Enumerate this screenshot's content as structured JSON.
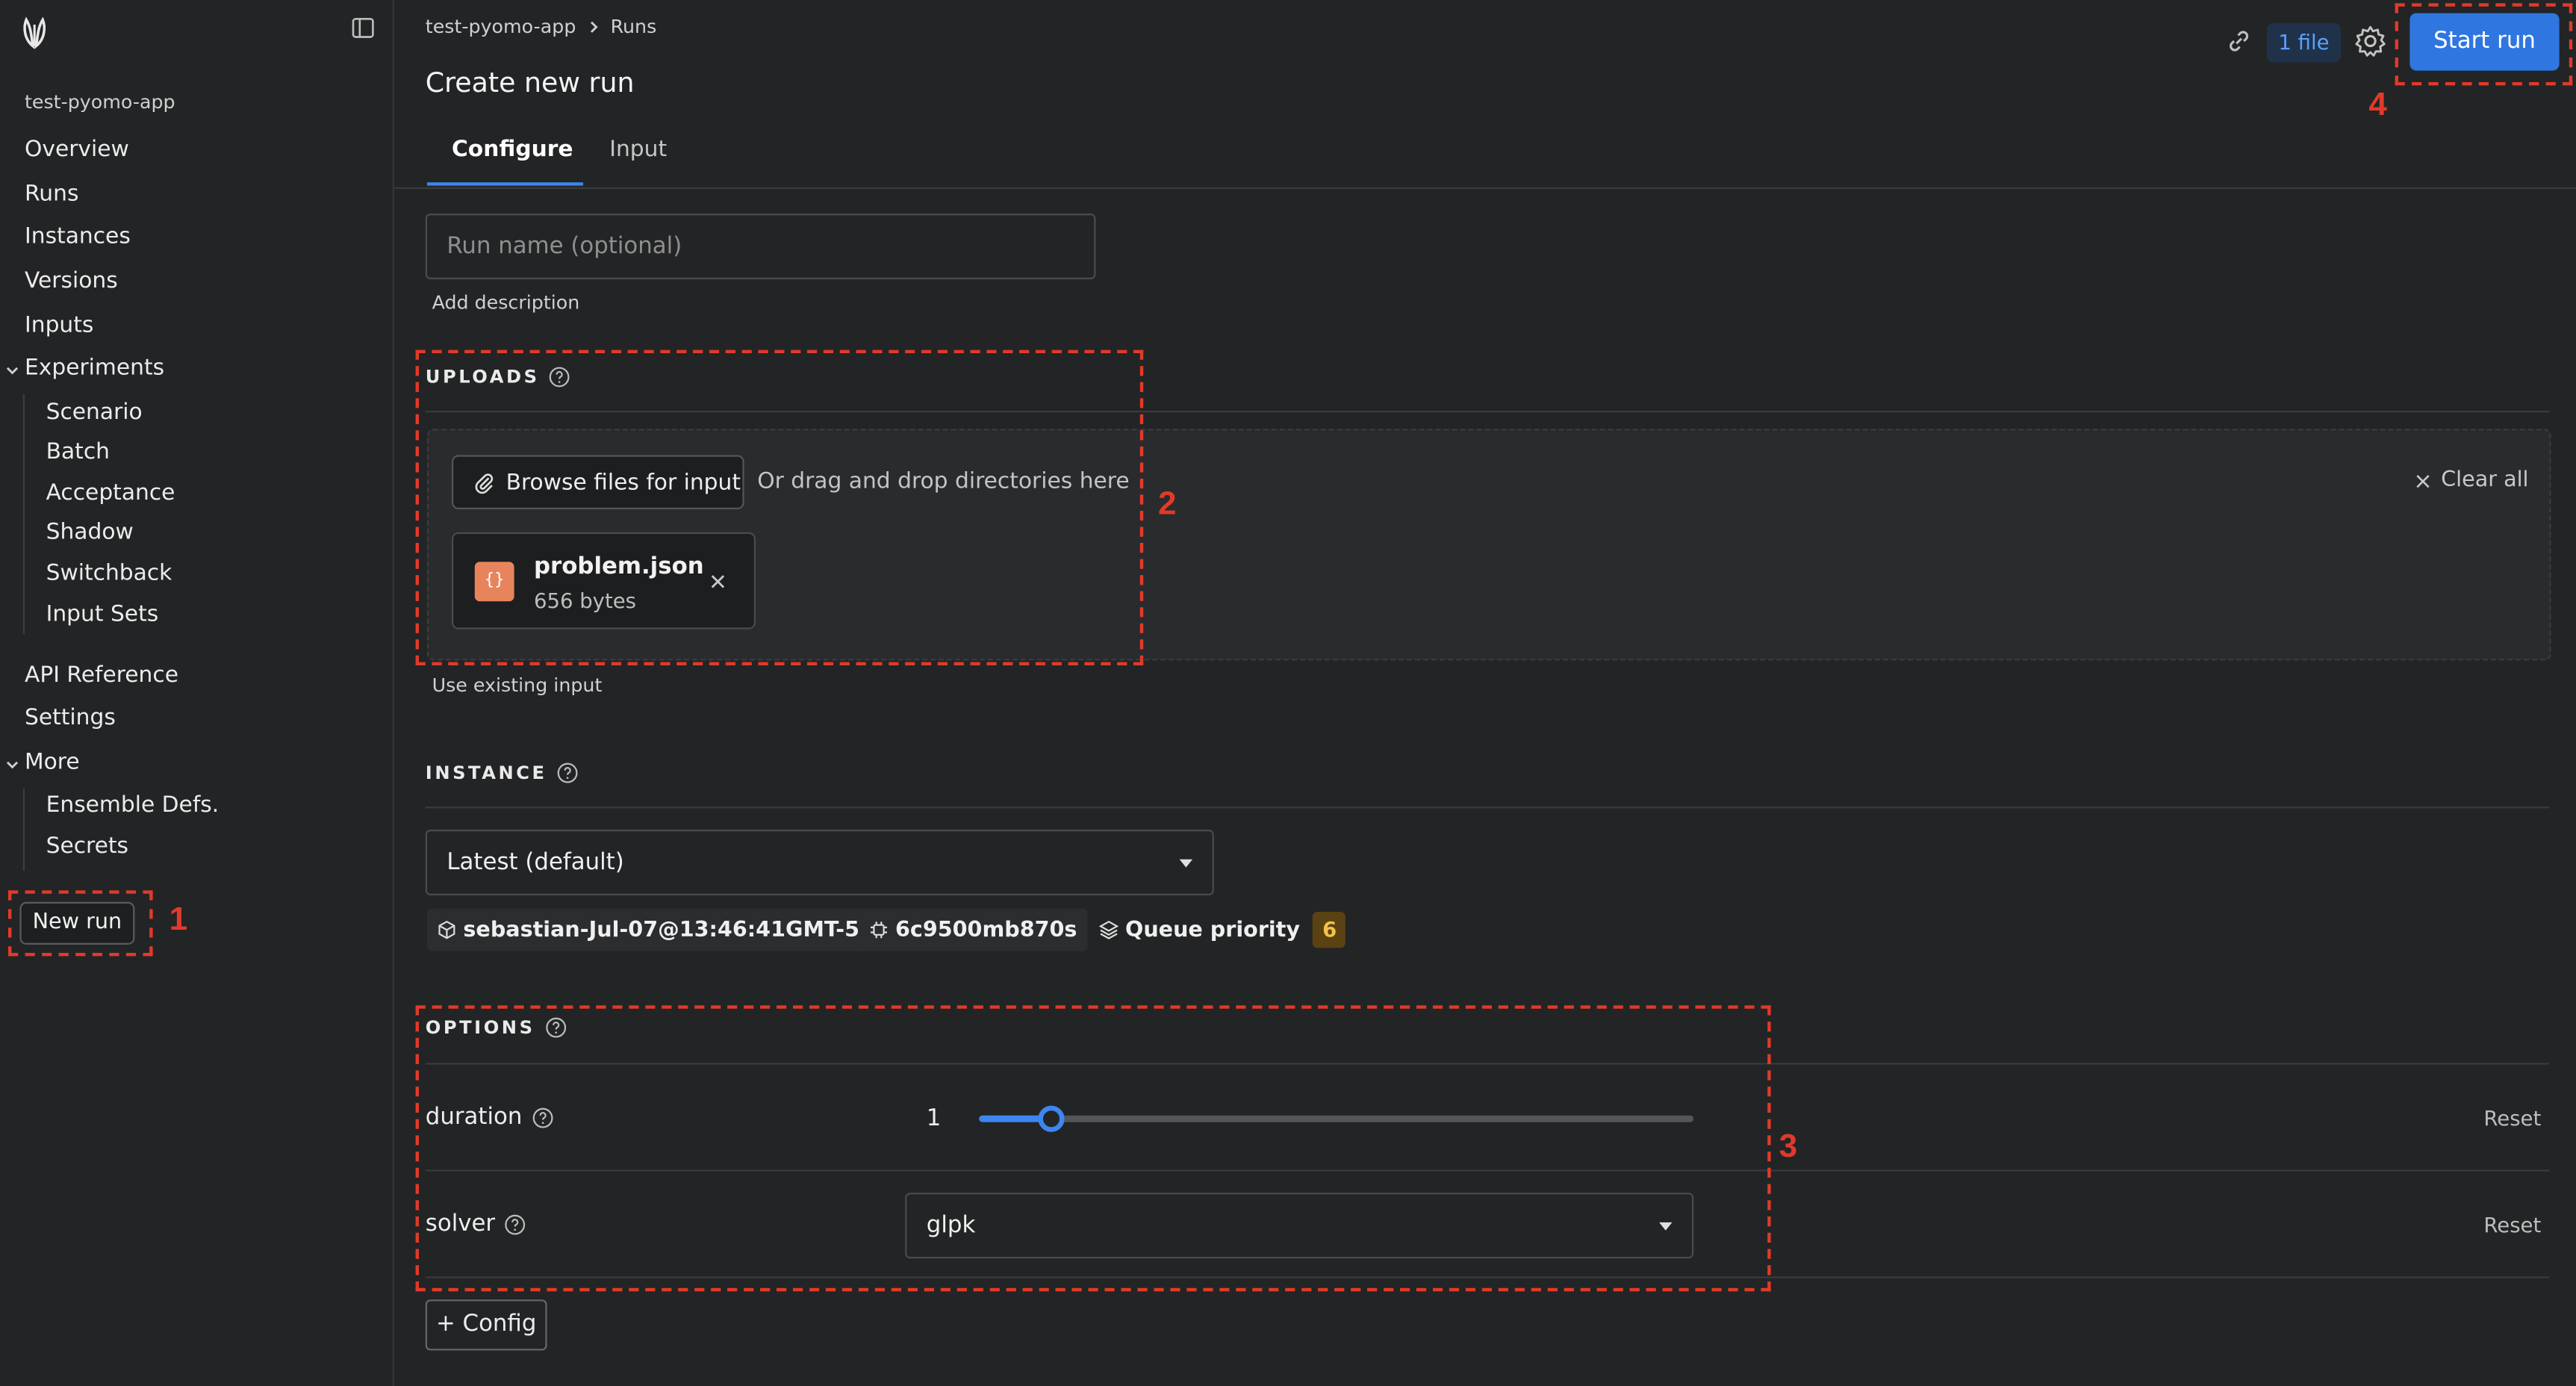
{
  "sidebar": {
    "app_name": "test-pyomo-app",
    "items": [
      {
        "label": "Overview"
      },
      {
        "label": "Runs"
      },
      {
        "label": "Instances"
      },
      {
        "label": "Versions"
      },
      {
        "label": "Inputs"
      },
      {
        "label": "Experiments"
      },
      {
        "label": "Scenario"
      },
      {
        "label": "Batch"
      },
      {
        "label": "Acceptance"
      },
      {
        "label": "Shadow"
      },
      {
        "label": "Switchback"
      },
      {
        "label": "Input Sets"
      },
      {
        "label": "API Reference"
      },
      {
        "label": "Settings"
      },
      {
        "label": "More"
      },
      {
        "label": "Ensemble Defs."
      },
      {
        "label": "Secrets"
      }
    ],
    "new_run_label": "New run"
  },
  "header": {
    "breadcrumb": [
      "test-pyomo-app",
      "Runs"
    ],
    "title": "Create new run",
    "file_badge": "1 file",
    "start_run_label": "Start run"
  },
  "tabs": [
    {
      "label": "Configure",
      "active": true
    },
    {
      "label": "Input",
      "active": false
    }
  ],
  "configure": {
    "run_name_placeholder": "Run name (optional)",
    "add_description": "Add description"
  },
  "uploads": {
    "label": "UPLOADS",
    "browse_label": "Browse files for input",
    "drag_text": "Or drag and drop directories here",
    "clear_all": "Clear all",
    "file": {
      "name": "problem.json",
      "size": "656 bytes",
      "icon_glyph": "{}"
    },
    "use_existing": "Use existing input"
  },
  "instance": {
    "label": "INSTANCE",
    "selected": "Latest (default)",
    "version": "sebastian-Jul-07@13:46:41GMT-5",
    "execution_class": "6c9500mb870s",
    "queue_priority_label": "Queue priority",
    "queue_priority_value": "6"
  },
  "options": {
    "label": "OPTIONS",
    "duration": {
      "label": "duration",
      "value": "1",
      "fraction": 0.1,
      "reset": "Reset"
    },
    "solver": {
      "label": "solver",
      "value": "glpk",
      "reset": "Reset"
    },
    "add_config": "+ Config"
  },
  "annotations": [
    "1",
    "2",
    "3",
    "4"
  ],
  "colors": {
    "background": "#232425",
    "accent": "#2f76e0",
    "annotation": "#e13a2a",
    "badge_text": "#5aa0ff",
    "queue_badge_bg": "#5a4213",
    "queue_badge_text": "#f2c24a",
    "file_icon": "#e8845c"
  },
  "icons": [
    "logo-icon",
    "sidebar-toggle-icon",
    "chevron-right-icon",
    "link-icon",
    "gear-icon",
    "help-icon",
    "paperclip-icon",
    "close-icon",
    "json-file-icon",
    "cube-icon",
    "chip-icon",
    "layers-icon",
    "caret-down-icon"
  ]
}
